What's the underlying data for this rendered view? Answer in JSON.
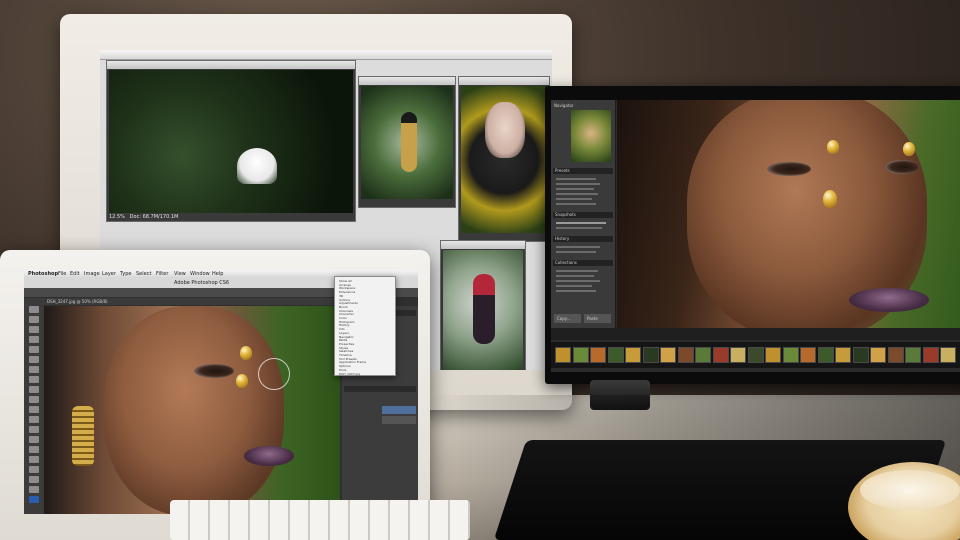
{
  "laptop": {
    "app_title": "Adobe Photoshop CS6",
    "menu_items": [
      "Photoshop",
      "File",
      "Edit",
      "Image",
      "Layer",
      "Type",
      "Select",
      "Filter",
      "View",
      "Window",
      "Help"
    ],
    "tab_title": "DSH_3247.jpg @ 50% (RGB/8)",
    "dropdown_items": [
      "Show All",
      "Arrange",
      "Workspace",
      "Extensions",
      "3D",
      "Actions",
      "Adjustments",
      "Brush",
      "Channels",
      "Character",
      "Color",
      "Histogram",
      "History",
      "Info",
      "Layers",
      "Navigator",
      "Paths",
      "Properties",
      "Styles",
      "Swatches",
      "Timeline",
      "Tool Presets",
      "Application Frame",
      "Options",
      "Tools",
      "DSH_3247.jpg"
    ],
    "panel_label": "No Properties"
  },
  "imac": {
    "status_zoom": "12.5%",
    "status_doc": "Doc: 68.7M/170.1M"
  },
  "monitor": {
    "panel_navigator": "Navigator",
    "panel_presets": "Presets",
    "panel_snapshots": "Snapshots",
    "panel_history": "History",
    "panel_collections": "Collections",
    "buttons": [
      "Copy...",
      "Paste"
    ],
    "thumb_count": 23
  }
}
